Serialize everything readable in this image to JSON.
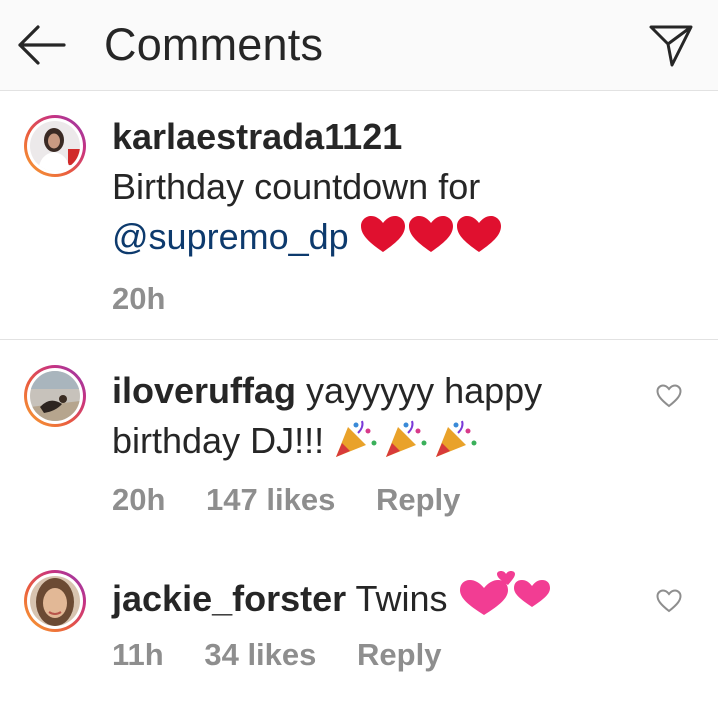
{
  "header": {
    "title": "Comments",
    "back_icon": "arrow-left-icon",
    "send_icon": "paper-plane-icon"
  },
  "caption": {
    "username": "karlaestrada1121",
    "text_line1": "Birthday countdown for",
    "mention": "@supremo_dp",
    "time": "20h",
    "emoji": "red-heart-x3"
  },
  "comments": [
    {
      "username": "iloveruffag",
      "text_part1": "yayyyyy happy",
      "text_part2": "birthday DJ!!!",
      "emoji": "party-popper-x3",
      "time": "20h",
      "likes": "147 likes",
      "reply": "Reply"
    },
    {
      "username": "jackie_forster",
      "text": "Twins",
      "emoji": "two-hearts",
      "time": "11h",
      "likes": "34 likes",
      "reply": "Reply"
    }
  ],
  "colors": {
    "text": "#262626",
    "mention": "#0d3a6d",
    "meta": "#8e8e8e",
    "heart_red": "#e0102f",
    "heart_pink": "#f23d93"
  }
}
